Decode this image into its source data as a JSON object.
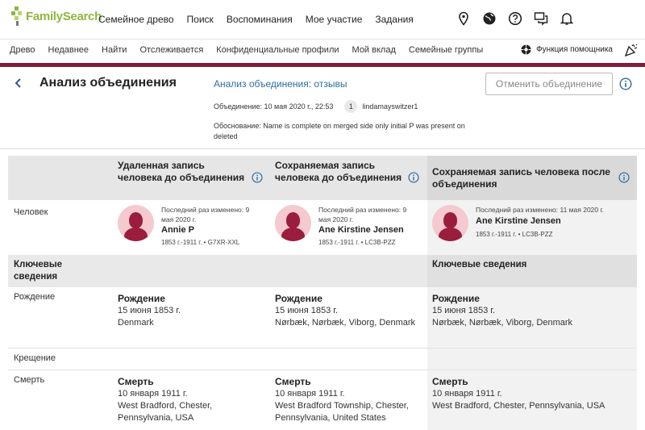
{
  "brand": {
    "name": "FamilySearch",
    "accent": "#8db83f",
    "bar_color": "#7f1d3a"
  },
  "top_nav": [
    "Семейное древо",
    "Поиск",
    "Воспоминания",
    "Мое участие",
    "Задания"
  ],
  "top_icons": [
    "location-pin-icon",
    "globe-icon",
    "help-icon",
    "chat-icon",
    "bell-icon"
  ],
  "sub_nav": [
    "Древо",
    "Недавнее",
    "Найти",
    "Отслеживается",
    "Конфиденциальные профили",
    "Мой вклад",
    "Семейные группы"
  ],
  "helper": {
    "label": "Функция помощника"
  },
  "page": {
    "title": "Анализ объединения",
    "review_link": "Анализ объединения: отзывы",
    "merge_label": "Объединение: 10 мая 2020 г., 22:53",
    "merge_count": "1",
    "user": "lindamayswitzer1",
    "reason": "Обоснование: Name is complete on merged side only initial P was present on deleted",
    "undo_button": "Отменить объединение"
  },
  "columns": [
    {
      "header": "Удаленная запись человека до объединения",
      "modified": "Последний раз изменено: 9 мая 2020 г.",
      "name": "Annie P",
      "life": "1853 г.-1911 г. • G7XR-XXL",
      "birth": {
        "title": "Рождение",
        "date": "15 июня 1853 г.",
        "place": "Denmark"
      },
      "death": {
        "title": "Смерть",
        "date": "10 января 1911 г.",
        "place": "West Bradford, Chester, Pennsylvania, USA"
      }
    },
    {
      "header": "Сохраняемая запись человека до объединения",
      "modified": "Последний раз изменено: 9 мая 2020 г.",
      "name": "Ane Kirstine Jensen",
      "life": "1853 г.-1911 г. • LC3B-PZZ",
      "birth": {
        "title": "Рождение",
        "date": "15 июня 1853 г.",
        "place": "Nørbæk, Nørbæk, Viborg, Denmark"
      },
      "death": {
        "title": "Смерть",
        "date": "10 января 1911 г.",
        "place": "West Bradford Township, Chester, Pennsylvania, United States"
      }
    },
    {
      "header": "Сохраняемая запись человека после объединения",
      "modified": "Последний раз изменено: 11 мая 2020 г.",
      "name": "Ane Kirstine Jensen",
      "life": "1853 г.-1911 г. • LC3B-PZZ",
      "key_facts": "Ключевые сведения",
      "birth": {
        "title": "Рождение",
        "date": "15 июня 1853 г.",
        "place": "Nørbæk, Nørbæk, Viborg, Denmark"
      },
      "death": {
        "title": "Смерть",
        "date": "10 января 1911 г.",
        "place": "West Bradford, Chester, Pennsylvania, USA"
      }
    }
  ],
  "row_labels": {
    "person": "Человек",
    "key_facts": "Ключевые сведения",
    "birth": "Рождение",
    "christening": "Крещение",
    "death": "Смерть"
  }
}
